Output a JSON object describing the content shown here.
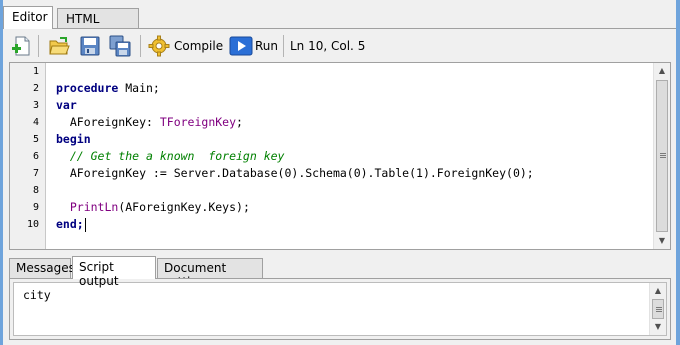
{
  "window": {
    "tabs": [
      {
        "label": "Editor",
        "active": true
      },
      {
        "label": "HTML output",
        "active": false
      }
    ]
  },
  "toolbar": {
    "new_icon": "new-document-icon",
    "open_icon": "open-folder-icon",
    "save_icon": "save-disk-icon",
    "save_all_icon": "save-all-icon",
    "compile_icon": "gear-icon",
    "compile_label": "Compile",
    "run_icon": "play-icon",
    "run_label": "Run",
    "cursor_position": "Ln 10, Col. 5"
  },
  "editor": {
    "line_numbers": [
      "1",
      "2",
      "3",
      "4",
      "5",
      "6",
      "7",
      "8",
      "9",
      "10"
    ],
    "lines": {
      "l2_kw": "procedure",
      "l2_rest": " Main;",
      "l3_kw": "var",
      "l4_id": "  AForeignKey: ",
      "l4_type": "TForeignKey",
      "l4_end": ";",
      "l5_kw": "begin",
      "l6_comment": "  // Get the a known  foreign key",
      "l7_code": "  AForeignKey := Server.Database(0).Schema(0).Table(1).ForeignKey(0);",
      "l9_indent": "  ",
      "l9_fn": "PrintLn",
      "l9_rest": "(AForeignKey.Keys);",
      "l10_kw": "end;"
    }
  },
  "bottom_tabs": [
    {
      "label": "Messages",
      "active": false
    },
    {
      "label": "Script output",
      "active": true
    },
    {
      "label": "Document settings",
      "active": false
    }
  ],
  "output": {
    "text": "city"
  },
  "colors": {
    "frame": "#6fa4dc",
    "keyword": "#000080",
    "type": "#800080",
    "comment": "#008000",
    "run_button": "#2b6fd6"
  }
}
